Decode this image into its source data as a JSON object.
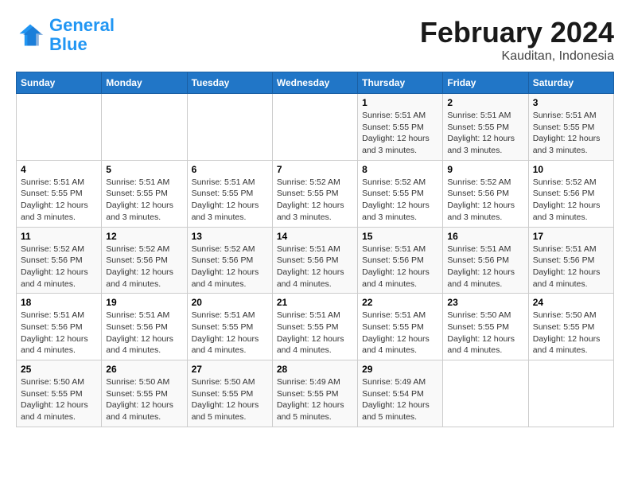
{
  "header": {
    "logo_general": "General",
    "logo_blue": "Blue",
    "month_title": "February 2024",
    "subtitle": "Kauditan, Indonesia"
  },
  "weekdays": [
    "Sunday",
    "Monday",
    "Tuesday",
    "Wednesday",
    "Thursday",
    "Friday",
    "Saturday"
  ],
  "weeks": [
    [
      {
        "num": "",
        "info": ""
      },
      {
        "num": "",
        "info": ""
      },
      {
        "num": "",
        "info": ""
      },
      {
        "num": "",
        "info": ""
      },
      {
        "num": "1",
        "info": "Sunrise: 5:51 AM\nSunset: 5:55 PM\nDaylight: 12 hours\nand 3 minutes."
      },
      {
        "num": "2",
        "info": "Sunrise: 5:51 AM\nSunset: 5:55 PM\nDaylight: 12 hours\nand 3 minutes."
      },
      {
        "num": "3",
        "info": "Sunrise: 5:51 AM\nSunset: 5:55 PM\nDaylight: 12 hours\nand 3 minutes."
      }
    ],
    [
      {
        "num": "4",
        "info": "Sunrise: 5:51 AM\nSunset: 5:55 PM\nDaylight: 12 hours\nand 3 minutes."
      },
      {
        "num": "5",
        "info": "Sunrise: 5:51 AM\nSunset: 5:55 PM\nDaylight: 12 hours\nand 3 minutes."
      },
      {
        "num": "6",
        "info": "Sunrise: 5:51 AM\nSunset: 5:55 PM\nDaylight: 12 hours\nand 3 minutes."
      },
      {
        "num": "7",
        "info": "Sunrise: 5:52 AM\nSunset: 5:55 PM\nDaylight: 12 hours\nand 3 minutes."
      },
      {
        "num": "8",
        "info": "Sunrise: 5:52 AM\nSunset: 5:55 PM\nDaylight: 12 hours\nand 3 minutes."
      },
      {
        "num": "9",
        "info": "Sunrise: 5:52 AM\nSunset: 5:56 PM\nDaylight: 12 hours\nand 3 minutes."
      },
      {
        "num": "10",
        "info": "Sunrise: 5:52 AM\nSunset: 5:56 PM\nDaylight: 12 hours\nand 3 minutes."
      }
    ],
    [
      {
        "num": "11",
        "info": "Sunrise: 5:52 AM\nSunset: 5:56 PM\nDaylight: 12 hours\nand 4 minutes."
      },
      {
        "num": "12",
        "info": "Sunrise: 5:52 AM\nSunset: 5:56 PM\nDaylight: 12 hours\nand 4 minutes."
      },
      {
        "num": "13",
        "info": "Sunrise: 5:52 AM\nSunset: 5:56 PM\nDaylight: 12 hours\nand 4 minutes."
      },
      {
        "num": "14",
        "info": "Sunrise: 5:51 AM\nSunset: 5:56 PM\nDaylight: 12 hours\nand 4 minutes."
      },
      {
        "num": "15",
        "info": "Sunrise: 5:51 AM\nSunset: 5:56 PM\nDaylight: 12 hours\nand 4 minutes."
      },
      {
        "num": "16",
        "info": "Sunrise: 5:51 AM\nSunset: 5:56 PM\nDaylight: 12 hours\nand 4 minutes."
      },
      {
        "num": "17",
        "info": "Sunrise: 5:51 AM\nSunset: 5:56 PM\nDaylight: 12 hours\nand 4 minutes."
      }
    ],
    [
      {
        "num": "18",
        "info": "Sunrise: 5:51 AM\nSunset: 5:56 PM\nDaylight: 12 hours\nand 4 minutes."
      },
      {
        "num": "19",
        "info": "Sunrise: 5:51 AM\nSunset: 5:56 PM\nDaylight: 12 hours\nand 4 minutes."
      },
      {
        "num": "20",
        "info": "Sunrise: 5:51 AM\nSunset: 5:55 PM\nDaylight: 12 hours\nand 4 minutes."
      },
      {
        "num": "21",
        "info": "Sunrise: 5:51 AM\nSunset: 5:55 PM\nDaylight: 12 hours\nand 4 minutes."
      },
      {
        "num": "22",
        "info": "Sunrise: 5:51 AM\nSunset: 5:55 PM\nDaylight: 12 hours\nand 4 minutes."
      },
      {
        "num": "23",
        "info": "Sunrise: 5:50 AM\nSunset: 5:55 PM\nDaylight: 12 hours\nand 4 minutes."
      },
      {
        "num": "24",
        "info": "Sunrise: 5:50 AM\nSunset: 5:55 PM\nDaylight: 12 hours\nand 4 minutes."
      }
    ],
    [
      {
        "num": "25",
        "info": "Sunrise: 5:50 AM\nSunset: 5:55 PM\nDaylight: 12 hours\nand 4 minutes."
      },
      {
        "num": "26",
        "info": "Sunrise: 5:50 AM\nSunset: 5:55 PM\nDaylight: 12 hours\nand 4 minutes."
      },
      {
        "num": "27",
        "info": "Sunrise: 5:50 AM\nSunset: 5:55 PM\nDaylight: 12 hours\nand 5 minutes."
      },
      {
        "num": "28",
        "info": "Sunrise: 5:49 AM\nSunset: 5:55 PM\nDaylight: 12 hours\nand 5 minutes."
      },
      {
        "num": "29",
        "info": "Sunrise: 5:49 AM\nSunset: 5:54 PM\nDaylight: 12 hours\nand 5 minutes."
      },
      {
        "num": "",
        "info": ""
      },
      {
        "num": "",
        "info": ""
      }
    ]
  ]
}
